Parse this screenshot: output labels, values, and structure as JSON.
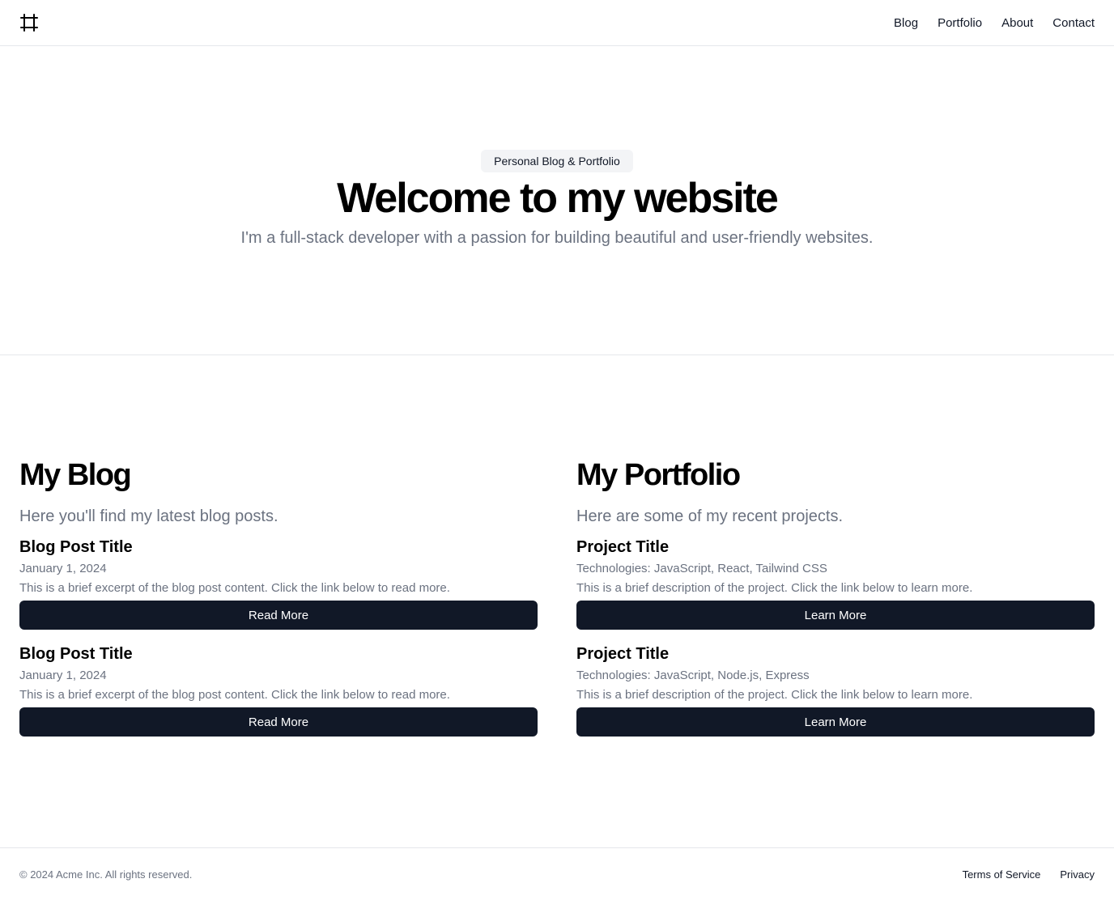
{
  "header": {
    "logo_icon": "frame-hash-icon",
    "nav": [
      {
        "label": "Blog"
      },
      {
        "label": "Portfolio"
      },
      {
        "label": "About"
      },
      {
        "label": "Contact"
      }
    ]
  },
  "hero": {
    "badge": "Personal Blog & Portfolio",
    "title": "Welcome to my website",
    "subtitle": "I'm a full-stack developer with a passion for building beautiful and user-friendly websites."
  },
  "blog": {
    "title": "My Blog",
    "subtitle": "Here you'll find my latest blog posts.",
    "posts": [
      {
        "title": "Blog Post Title",
        "date": "January 1, 2024",
        "excerpt": "This is a brief excerpt of the blog post content. Click the link below to read more.",
        "button": "Read More"
      },
      {
        "title": "Blog Post Title",
        "date": "January 1, 2024",
        "excerpt": "This is a brief excerpt of the blog post content. Click the link below to read more.",
        "button": "Read More"
      }
    ]
  },
  "portfolio": {
    "title": "My Portfolio",
    "subtitle": "Here are some of my recent projects.",
    "projects": [
      {
        "title": "Project Title",
        "tech": "Technologies: JavaScript, React, Tailwind CSS",
        "description": "This is a brief description of the project. Click the link below to learn more.",
        "button": "Learn More"
      },
      {
        "title": "Project Title",
        "tech": "Technologies: JavaScript, Node.js, Express",
        "description": "This is a brief description of the project. Click the link below to learn more.",
        "button": "Learn More"
      }
    ]
  },
  "footer": {
    "copyright": "© 2024 Acme Inc. All rights reserved.",
    "links": [
      {
        "label": "Terms of Service"
      },
      {
        "label": "Privacy"
      }
    ]
  },
  "colors": {
    "button_bg": "#111827",
    "muted_text": "#6b7280",
    "border": "#e5e7eb",
    "badge_bg": "#f3f4f6"
  }
}
